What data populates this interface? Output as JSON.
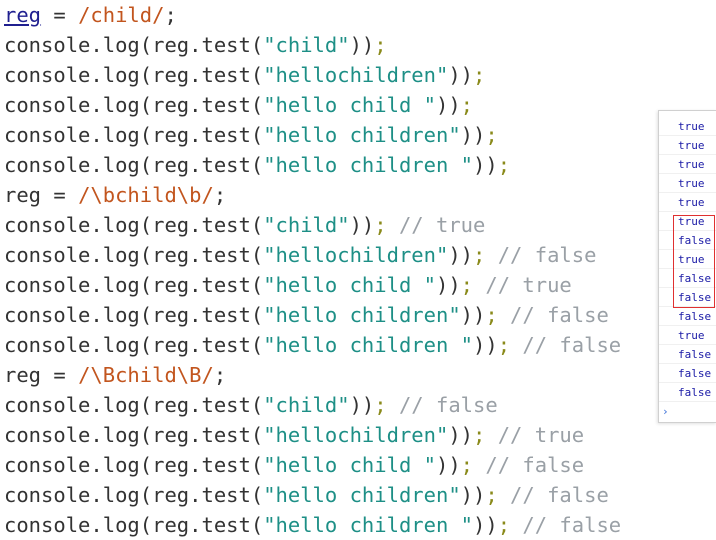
{
  "code_lines": [
    {
      "kind": "assign",
      "var": "reg",
      "eq": " = ",
      "regex": "/child/",
      "end": ";"
    },
    {
      "kind": "log",
      "pre": "console.log(reg.test(",
      "str": "\"child\"",
      "post": "))",
      "semi": ";",
      "comment": ""
    },
    {
      "kind": "log",
      "pre": "console.log(reg.test(",
      "str": "\"hellochildren\"",
      "post": "))",
      "semi": ";",
      "comment": ""
    },
    {
      "kind": "log",
      "pre": "console.log(reg.test(",
      "str": "\"hello child \"",
      "post": "))",
      "semi": ";",
      "comment": ""
    },
    {
      "kind": "log",
      "pre": "console.log(reg.test(",
      "str": "\"hello children\"",
      "post": "))",
      "semi": ";",
      "comment": ""
    },
    {
      "kind": "log",
      "pre": "console.log(reg.test(",
      "str": "\"hello children \"",
      "post": "))",
      "semi": ";",
      "comment": ""
    },
    {
      "kind": "assign",
      "var": "reg",
      "eq": " = ",
      "regex": "/\\bchild\\b/",
      "end": ";"
    },
    {
      "kind": "log",
      "pre": "console.log(reg.test(",
      "str": "\"child\"",
      "post": "))",
      "semi": ";",
      "comment": " // true"
    },
    {
      "kind": "log",
      "pre": "console.log(reg.test(",
      "str": "\"hellochildren\"",
      "post": "))",
      "semi": ";",
      "comment": " // false"
    },
    {
      "kind": "log",
      "pre": "console.log(reg.test(",
      "str": "\"hello child \"",
      "post": "))",
      "semi": ";",
      "comment": " // true"
    },
    {
      "kind": "log",
      "pre": "console.log(reg.test(",
      "str": "\"hello children\"",
      "post": "))",
      "semi": ";",
      "comment": " // false"
    },
    {
      "kind": "log",
      "pre": "console.log(reg.test(",
      "str": "\"hello children \"",
      "post": "))",
      "semi": ";",
      "comment": " // false"
    },
    {
      "kind": "assign",
      "var": "reg",
      "eq": " = ",
      "regex": "/\\Bchild\\B/",
      "end": ";"
    },
    {
      "kind": "log",
      "pre": "console.log(reg.test(",
      "str": "\"child\"",
      "post": "))",
      "semi": ";",
      "comment": " // false"
    },
    {
      "kind": "log",
      "pre": "console.log(reg.test(",
      "str": "\"hellochildren\"",
      "post": "))",
      "semi": ";",
      "comment": " // true"
    },
    {
      "kind": "log",
      "pre": "console.log(reg.test(",
      "str": "\"hello child \"",
      "post": "))",
      "semi": ";",
      "comment": " // false"
    },
    {
      "kind": "log",
      "pre": "console.log(reg.test(",
      "str": "\"hello children\"",
      "post": "))",
      "semi": ";",
      "comment": " // false"
    },
    {
      "kind": "log",
      "pre": "console.log(reg.test(",
      "str": "\"hello children \"",
      "post": "))",
      "semi": ";",
      "comment": " // false"
    }
  ],
  "console_output": [
    "true",
    "true",
    "true",
    "true",
    "true",
    "true",
    "false",
    "true",
    "false",
    "false",
    "false",
    "true",
    "false",
    "false",
    "false"
  ],
  "console_prompt": "›",
  "colors": {
    "regex": "#c2551e",
    "string": "#1d8f86",
    "comment": "#9aa0a6",
    "console_value": "#1a1aa6",
    "highlight_border": "#e03030"
  }
}
